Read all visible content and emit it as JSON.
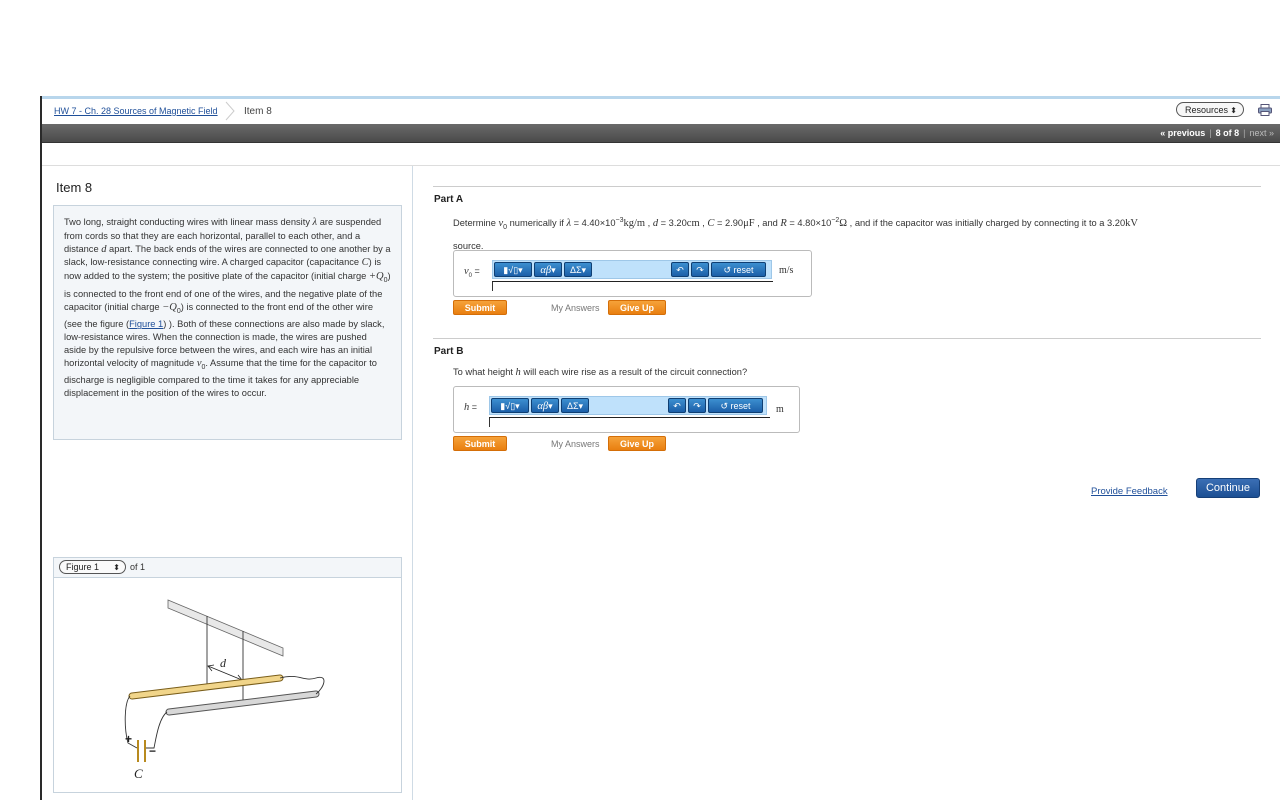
{
  "nav": {
    "breadcrumb_link": "HW 7 - Ch. 28 Sources of Magnetic Field",
    "breadcrumb_current": "Item 8",
    "resources_label": "Resources",
    "pager_previous": "« previous",
    "pager_position": "8 of 8",
    "pager_next": "next »"
  },
  "item": {
    "title": "Item 8",
    "problem": {
      "p1": "Two long, straight conducting wires with linear mass density ",
      "lambda": "λ",
      "p2": " are suspended from cords so that they are each horizontal, parallel to each other, and a distance ",
      "d": "d",
      "p3": " apart. The back ends of the wires are connected to one another by a slack, low-resistance connecting wire. A charged capacitor (capacitance ",
      "C": "C",
      "p4": ") is now added to the system; the positive plate of the capacitor (initial charge ",
      "plusQ0": "+Q",
      "p5": ") is connected to the front end of one of the wires, and the negative plate of the capacitor (initial charge ",
      "minusQ0": "−Q",
      "p6": ") is connected to the front end of the other wire (see the figure (",
      "figure_link": "Figure 1",
      "p7": ") ). Both of these connections are also made by slack, low-resistance wires. When the connection is made, the wires are pushed aside by the repulsive force between the wires, and each wire has an initial horizontal velocity of magnitude ",
      "v0": "v",
      "p8": ". Assume that the time for the capacitor to discharge is negligible compared to the time it takes for any appreciable displacement in the position of the wires to occur."
    },
    "figure": {
      "select_value": "Figure 1",
      "of_text": "of 1",
      "label_d": "d",
      "label_C": "C",
      "label_plus": "+",
      "label_minus": "−"
    }
  },
  "partA": {
    "title": "Part A",
    "q_determine": "Determine ",
    "q_v": "v",
    "q_numerically": " numerically if ",
    "q_lambda": "λ",
    "q_eq1": " = 4.40×10",
    "q_exp1": "−3",
    "q_unit1": "kg/m",
    "q_comma1": " , ",
    "q_d": "d",
    "q_eq2": " = 3.20",
    "q_unit2": "cm",
    "q_comma2": " , ",
    "q_C": "C",
    "q_eq3": " = 2.90",
    "q_unit3": "μF",
    "q_and": " , and ",
    "q_R": "R",
    "q_eq4": " = 4.80×10",
    "q_exp2": "−2",
    "q_unit4": "Ω",
    "q_rest": " , and if the capacitor was initially charged by connecting it to a 3.20",
    "q_unit5": "kV",
    "q_line2": "source.",
    "answer_label_var": "v",
    "answer_label_eq": " =",
    "unit": "m/s",
    "tool_templates": "▮√▯",
    "tool_greek": "αβ",
    "tool_symbols": "ΔΣ",
    "tool_reset": "reset",
    "submit": "Submit",
    "my_answers": "My Answers",
    "give_up": "Give Up"
  },
  "partB": {
    "title": "Part B",
    "q_pre": "To what height ",
    "q_h": "h",
    "q_post": " will each wire rise as a result of the circuit connection?",
    "answer_label_var": "h",
    "answer_label_eq": " =",
    "unit": "m",
    "tool_templates": "▮√▯",
    "tool_greek": "αβ",
    "tool_symbols": "ΔΣ",
    "tool_reset": "reset",
    "submit": "Submit",
    "my_answers": "My Answers",
    "give_up": "Give Up"
  },
  "footer": {
    "feedback": "Provide Feedback",
    "continue": "Continue"
  }
}
